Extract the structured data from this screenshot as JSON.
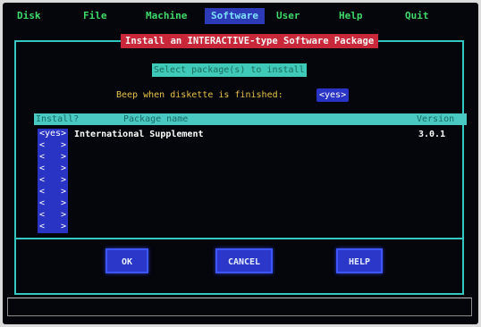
{
  "menu": {
    "items": [
      {
        "label": "Disk"
      },
      {
        "label": "File"
      },
      {
        "label": "Machine"
      },
      {
        "label": "Software"
      },
      {
        "label": "User"
      },
      {
        "label": "Help"
      },
      {
        "label": "Quit"
      }
    ]
  },
  "dialog": {
    "title": "Install an INTERACTIVE-type Software Package",
    "prompt": "Select package(s) to install",
    "beep_label": "Beep when diskette is finished:",
    "beep_value": "<yes>"
  },
  "table": {
    "headers": {
      "install": "Install?",
      "package": "Package name",
      "version": "Version"
    },
    "rows": [
      {
        "install": "<yes>",
        "package": "International Supplement",
        "version": "3.0.1"
      },
      {
        "install": "<   >"
      },
      {
        "install": "<   >"
      },
      {
        "install": "<   >"
      },
      {
        "install": "<   >"
      },
      {
        "install": "<   >"
      },
      {
        "install": "<   >"
      },
      {
        "install": "<   >"
      },
      {
        "install": "<   >"
      }
    ]
  },
  "buttons": {
    "ok": "OK",
    "cancel": "CANCEL",
    "help": "HELP"
  },
  "colors": {
    "menu_text": "#3fd96a",
    "menu_active_bg": "#2c3ab8",
    "border": "#34c6c0",
    "title_bg": "#c9283a",
    "button_bg": "#2a37c8"
  }
}
